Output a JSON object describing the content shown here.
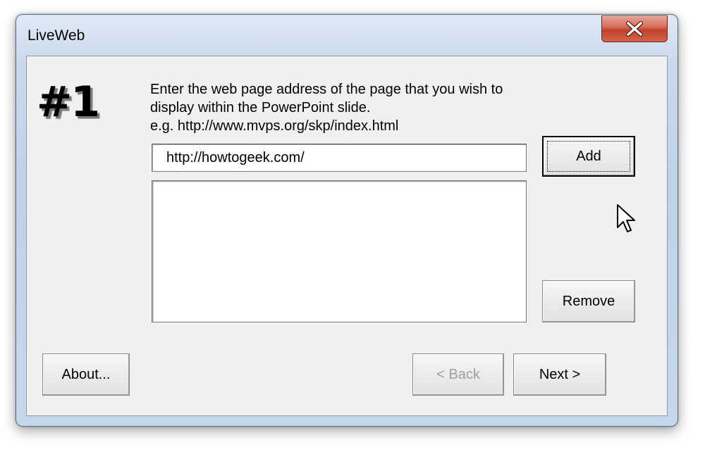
{
  "window": {
    "title": "LiveWeb",
    "close_icon": "close-icon"
  },
  "step": {
    "number": "#1"
  },
  "instructions": {
    "line1": "Enter the web page address of the page that you wish to",
    "line2": "display within the PowerPoint slide.",
    "line3": "e.g. http://www.mvps.org/skp/index.html"
  },
  "url_field": {
    "value": "http://howtogeek.com/"
  },
  "url_list": {
    "items": []
  },
  "buttons": {
    "add": "Add",
    "remove": "Remove",
    "about": "About...",
    "back": "< Back",
    "next": "Next >"
  },
  "colors": {
    "close_button": "#c2432c",
    "client_background": "#f0f0f0",
    "disabled_text": "#a0a0a0"
  }
}
